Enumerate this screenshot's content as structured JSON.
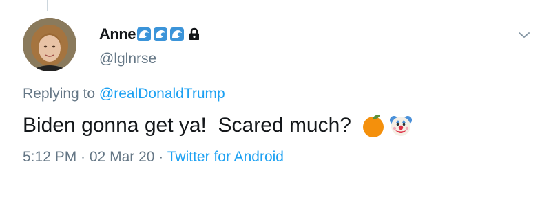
{
  "tweet": {
    "display_name": "Anne",
    "name_emojis": [
      "wave-emoji",
      "wave-emoji",
      "wave-emoji"
    ],
    "protected_icon": "lock-icon",
    "handle": "@lglnrse",
    "replying_prefix": "Replying to ",
    "replying_to": "@realDonaldTrump",
    "text": "Biden gonna get ya!  Scared much?",
    "text_emojis": [
      "orange-emoji",
      "clown-face-emoji"
    ],
    "time": "5:12 PM",
    "separator": " · ",
    "date": "02 Mar 20",
    "client": "Twitter for Android",
    "menu_icon": "chevron-down-icon"
  },
  "colors": {
    "text": "#14171a",
    "secondary": "#657786",
    "accent": "#1da1f2",
    "divider": "#e1e8ed"
  }
}
